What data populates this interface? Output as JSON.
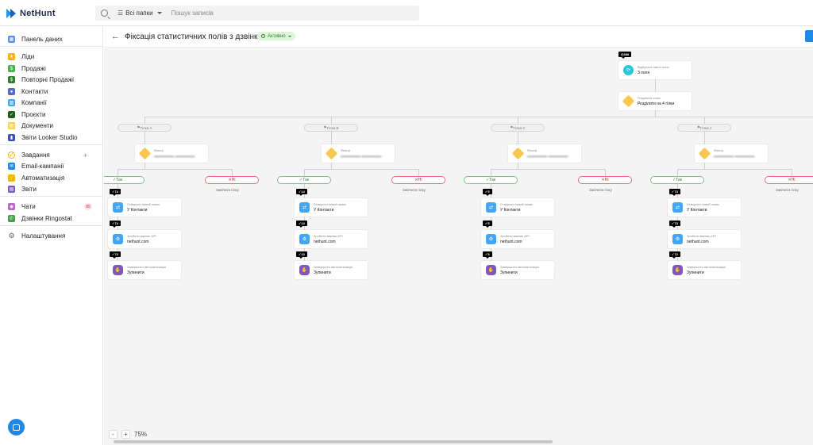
{
  "app": {
    "name": "NetHunt"
  },
  "header": {
    "folders_label": "Всі папки",
    "search_placeholder": "Пошук записів"
  },
  "sidebar": {
    "items": [
      {
        "label": "Панель даних",
        "icon": "dashboard-icon",
        "color": "#5b8def"
      },
      {
        "label": "Ліди",
        "icon": "star-icon",
        "color": "#f5b400"
      },
      {
        "label": "Продажі",
        "icon": "dollar-icon",
        "color": "#4caf50"
      },
      {
        "label": "Повторні Продажі",
        "icon": "dollar-dark-icon",
        "color": "#2e7d32"
      },
      {
        "label": "Контакти",
        "icon": "people-icon",
        "color": "#5c6bc0"
      },
      {
        "label": "Компанії",
        "icon": "building-icon",
        "color": "#42a5f5"
      },
      {
        "label": "Проєкти",
        "icon": "check-square-icon",
        "color": "#1b5e20"
      },
      {
        "label": "Документи",
        "icon": "document-icon",
        "color": "#f9d34b"
      },
      {
        "label": "Звіти Looker Studio",
        "icon": "bar-chart-icon",
        "color": "#3f51b5"
      },
      {
        "label": "Завдання",
        "icon": "check-circle-icon",
        "color": "#f5b400"
      },
      {
        "label": "Email-кампанії",
        "icon": "email-icon",
        "color": "#1e88e5"
      },
      {
        "label": "Автоматизація",
        "icon": "lightning-icon",
        "color": "#f5b400"
      },
      {
        "label": "Звіти",
        "icon": "report-icon",
        "color": "#7e57c2"
      },
      {
        "label": "Чати",
        "icon": "chat-icon",
        "color": "#ba68c8",
        "badge": "85"
      },
      {
        "label": "Дзвінки Ringostat",
        "icon": "phone-icon",
        "color": "#43a047"
      },
      {
        "label": "Налаштування",
        "icon": "gear-icon",
        "color": "#616161"
      }
    ]
  },
  "workflow": {
    "title": "Фіксація статистичних полів з дзвінка",
    "status": "Активно",
    "zoom": "75%",
    "trigger": {
      "counter": "388",
      "label": "Відбулась зміна поля",
      "value": "3 поля"
    },
    "splitter": {
      "label": "Розділити шлях",
      "value": "Розділити на 4 гілки"
    },
    "branches": [
      {
        "name": "Гілка A",
        "filter_label": "Фільтр",
        "yes": "Так",
        "no": "Ні",
        "end_text": "Завічити гілку",
        "steps": [
          {
            "counter": "74",
            "label": "Створити новий запис",
            "value": "У Контакти"
          },
          {
            "counter": "74",
            "label": "Зробити виклик API",
            "value": "nethunt.com"
          },
          {
            "counter": "73",
            "label": "Завершити автоматизацію",
            "value": "Зупинити"
          }
        ]
      },
      {
        "name": "Гілка B",
        "filter_label": "Фільтр",
        "yes": "Так",
        "no": "Ні",
        "end_text": "Завічити гілку",
        "steps": [
          {
            "counter": "14",
            "label": "Створити новий запис",
            "value": "У Контакти"
          },
          {
            "counter": "13",
            "label": "Зробити виклик API",
            "value": "nethunt.com"
          },
          {
            "counter": "13",
            "label": "Завершити автоматизацію",
            "value": "Зупинити"
          }
        ]
      },
      {
        "name": "Гілка C",
        "filter_label": "Фільтр",
        "yes": "Так",
        "no": "Ні",
        "end_text": "Завічити гілку",
        "steps": [
          {
            "counter": "5",
            "label": "Створити новий запис",
            "value": "У Контакти"
          },
          {
            "counter": "5",
            "label": "Зробити виклик API",
            "value": "nethunt.com"
          },
          {
            "counter": "5",
            "label": "Завершити автоматизацію",
            "value": "Зупинити"
          }
        ]
      },
      {
        "name": "Гілка J",
        "filter_label": "Фільтр",
        "yes": "Так",
        "no": "Ні",
        "end_text": "Завічити гілку",
        "steps": [
          {
            "counter": "73",
            "label": "Створити новий запис",
            "value": "У Контакти"
          },
          {
            "counter": "73",
            "label": "Зробити виклик API",
            "value": "nethunt.com"
          },
          {
            "counter": "72",
            "label": "Завершити автоматизацію",
            "value": "Зупинити"
          }
        ]
      }
    ]
  }
}
